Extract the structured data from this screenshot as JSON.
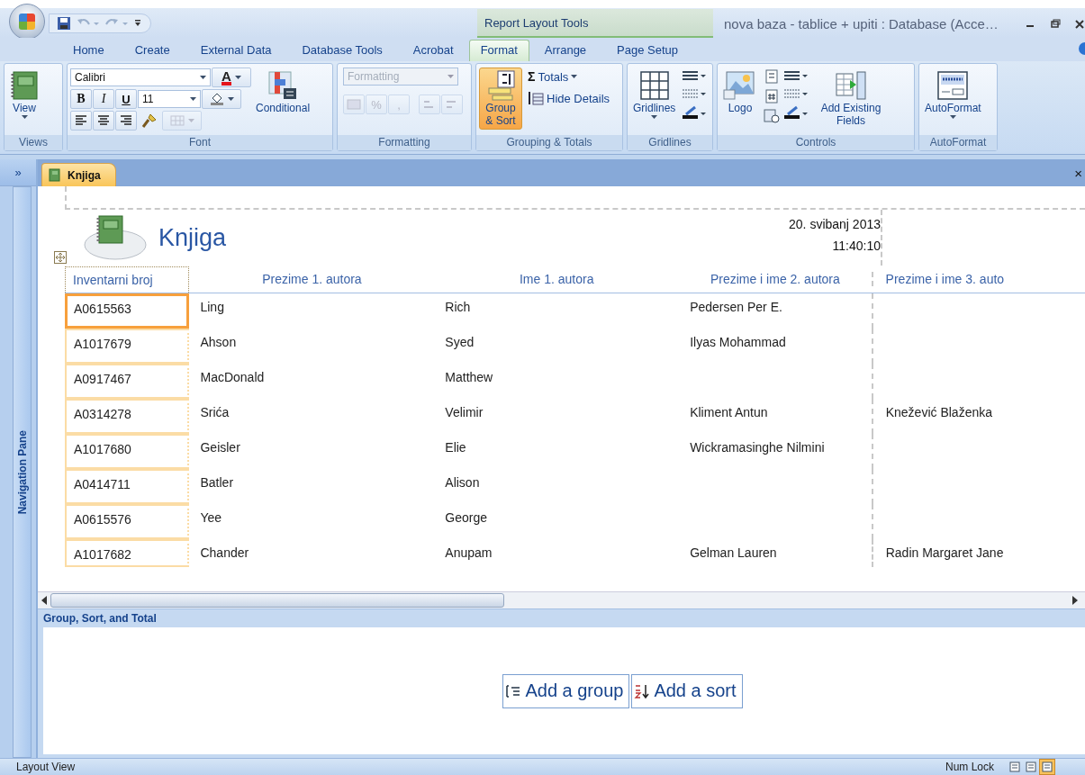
{
  "window": {
    "title": "nova baza - tablice + upiti : Database (Acce…",
    "context_tab_group": "Report Layout Tools"
  },
  "tabs": [
    {
      "label": "Home",
      "selected": false
    },
    {
      "label": "Create",
      "selected": false
    },
    {
      "label": "External Data",
      "selected": false
    },
    {
      "label": "Database Tools",
      "selected": false
    },
    {
      "label": "Acrobat",
      "selected": false
    },
    {
      "label": "Format",
      "selected": true
    },
    {
      "label": "Arrange",
      "selected": false
    },
    {
      "label": "Page Setup",
      "selected": false
    }
  ],
  "ribbon": {
    "views": {
      "label": "Views",
      "view_button": "View"
    },
    "font": {
      "label": "Font",
      "font_name": "Calibri",
      "font_size": "11",
      "bold": "B",
      "italic": "I",
      "underline": "U",
      "font_color": "A",
      "conditional": "Conditional"
    },
    "formatting": {
      "label": "Formatting",
      "placeholder": "Formatting",
      "percent": "%",
      "comma": ",",
      "disabled": true
    },
    "grouping": {
      "label": "Grouping & Totals",
      "group_sort": {
        "label": "Group & Sort",
        "selected": true
      },
      "sigma": "Σ",
      "totals": "Totals",
      "hide_details": "Hide Details"
    },
    "gridlines": {
      "label": "Gridlines",
      "gridlines_button": "Gridlines"
    },
    "controls": {
      "label": "Controls",
      "logo": "Logo",
      "add_fields": "Add Existing Fields"
    },
    "autoformat": {
      "label": "AutoFormat",
      "autoformat_button": "AutoFormat"
    }
  },
  "navigation_pane": {
    "expand": "»",
    "label": "Navigation Pane"
  },
  "document_tab": {
    "label": "Knjiga",
    "close": "×"
  },
  "report": {
    "title": "Knjiga",
    "date": "20. svibanj 2013",
    "time": "11:40:10",
    "columns": [
      "Inventarni broj",
      "Prezime 1. autora",
      "Ime 1. autora",
      "Prezime i ime 2. autora",
      "Prezime i ime 3. auto"
    ],
    "rows": [
      {
        "selected": true,
        "inventarni_broj": "A0615563",
        "prezime_1": "Ling",
        "ime_1": "Rich",
        "autor_2": "Pedersen Per E."
      },
      {
        "selected": false,
        "inventarni_broj": "A1017679",
        "prezime_1": "Ahson",
        "ime_1": "Syed",
        "autor_2": "Ilyas Mohammad"
      },
      {
        "selected": false,
        "inventarni_broj": "A0917467",
        "prezime_1": "MacDonald",
        "ime_1": "Matthew"
      },
      {
        "selected": false,
        "inventarni_broj": "A0314278",
        "prezime_1": "Srića",
        "ime_1": "Velimir",
        "autor_2": "Kliment Antun",
        "autor_3": "Knežević Blaženka"
      },
      {
        "selected": false,
        "inventarni_broj": "A1017680",
        "prezime_1": "Geisler",
        "ime_1": "Elie",
        "autor_2": "Wickramasinghe Nilmini"
      },
      {
        "selected": false,
        "inventarni_broj": "A0414711",
        "prezime_1": "Batler",
        "ime_1": "Alison"
      },
      {
        "selected": false,
        "inventarni_broj": "A0615576",
        "prezime_1": "Yee",
        "ime_1": "George"
      },
      {
        "selected": false,
        "inventarni_broj": "A1017682",
        "prezime_1": "Chander",
        "ime_1": "Anupam",
        "autor_2": "Gelman Lauren",
        "autor_3": "Radin Margaret Jane"
      }
    ]
  },
  "group_sort_pane": {
    "title": "Group, Sort, and Total",
    "add_group": "Add a group",
    "add_sort": "Add a sort"
  },
  "status_bar": {
    "mode": "Layout View",
    "num_lock": "Num Lock",
    "views": [
      {
        "selected": false
      },
      {
        "selected": false
      },
      {
        "selected": true
      }
    ]
  }
}
